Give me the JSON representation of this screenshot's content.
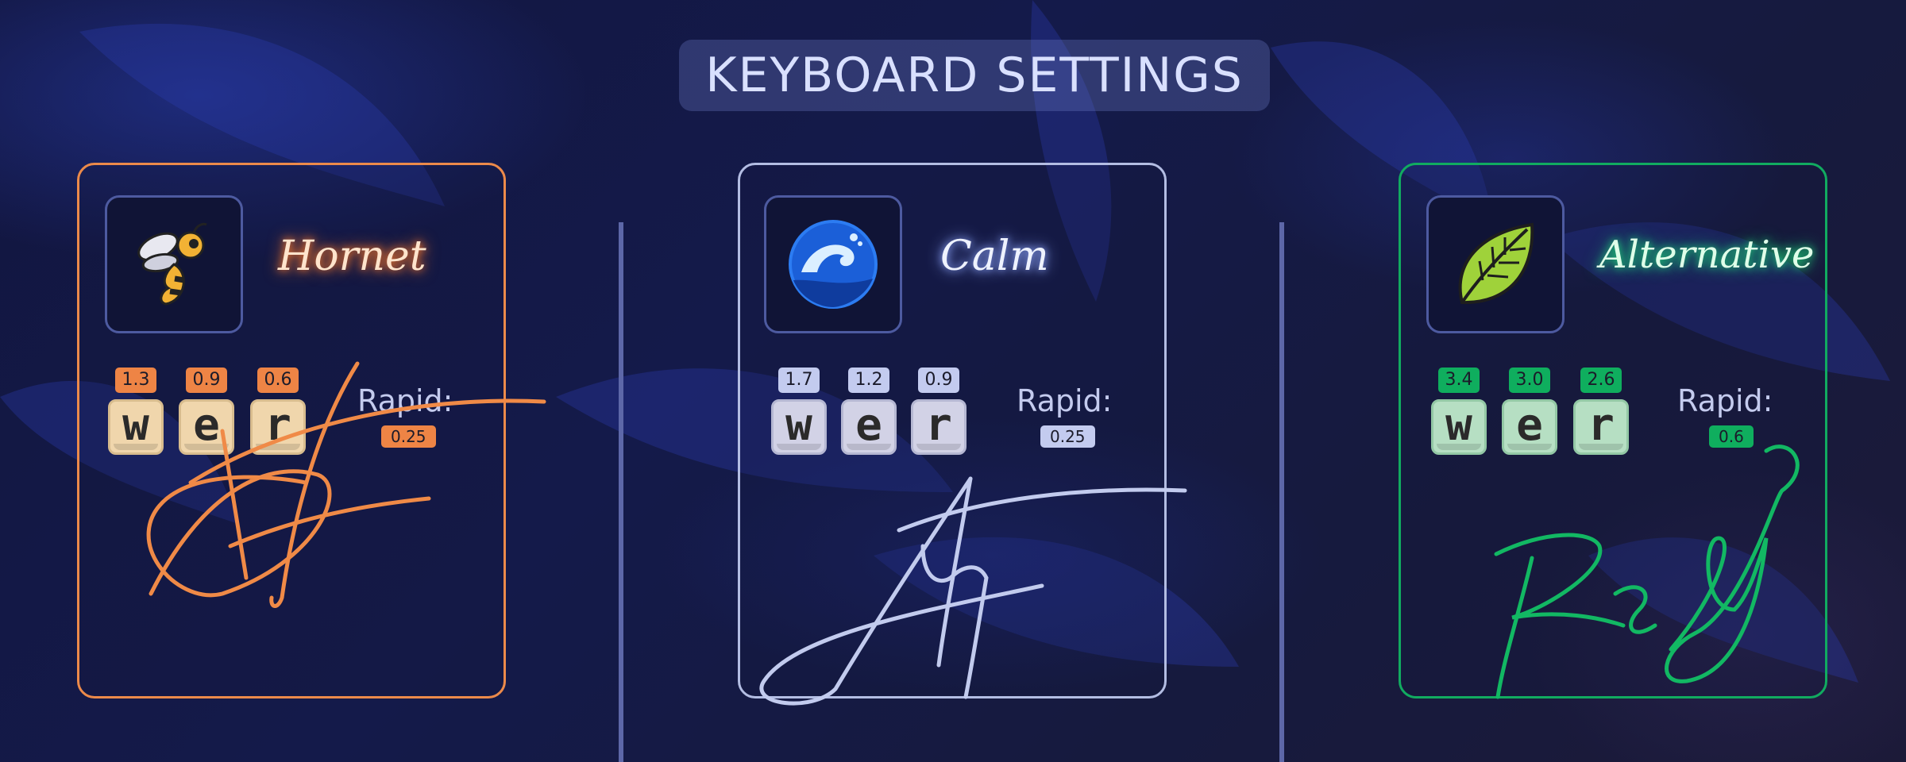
{
  "title": "KEYBOARD SETTINGS",
  "profiles": [
    {
      "name": "Hornet",
      "icon": "bee-icon",
      "accent": "#ec8a4a",
      "keys": [
        {
          "label": "w",
          "value": "1.3"
        },
        {
          "label": "e",
          "value": "0.9"
        },
        {
          "label": "r",
          "value": "0.6"
        }
      ],
      "rapid_label": "Rapid:",
      "rapid_value": "0.25",
      "signature_text": "DJ"
    },
    {
      "name": "Calm",
      "icon": "ocean-wave-icon",
      "accent": "#b3bde3",
      "keys": [
        {
          "label": "w",
          "value": "1.7"
        },
        {
          "label": "e",
          "value": "1.2"
        },
        {
          "label": "r",
          "value": "0.9"
        }
      ],
      "rapid_label": "Rapid:",
      "rapid_value": "0.25",
      "signature_text": "AY"
    },
    {
      "name": "Alternative",
      "icon": "leaf-icon",
      "accent": "#11ab60",
      "keys": [
        {
          "label": "w",
          "value": "3.4"
        },
        {
          "label": "e",
          "value": "3.0"
        },
        {
          "label": "r",
          "value": "2.6"
        }
      ],
      "rapid_label": "Rapid:",
      "rapid_value": "0.6",
      "signature_text": "ReG"
    }
  ]
}
